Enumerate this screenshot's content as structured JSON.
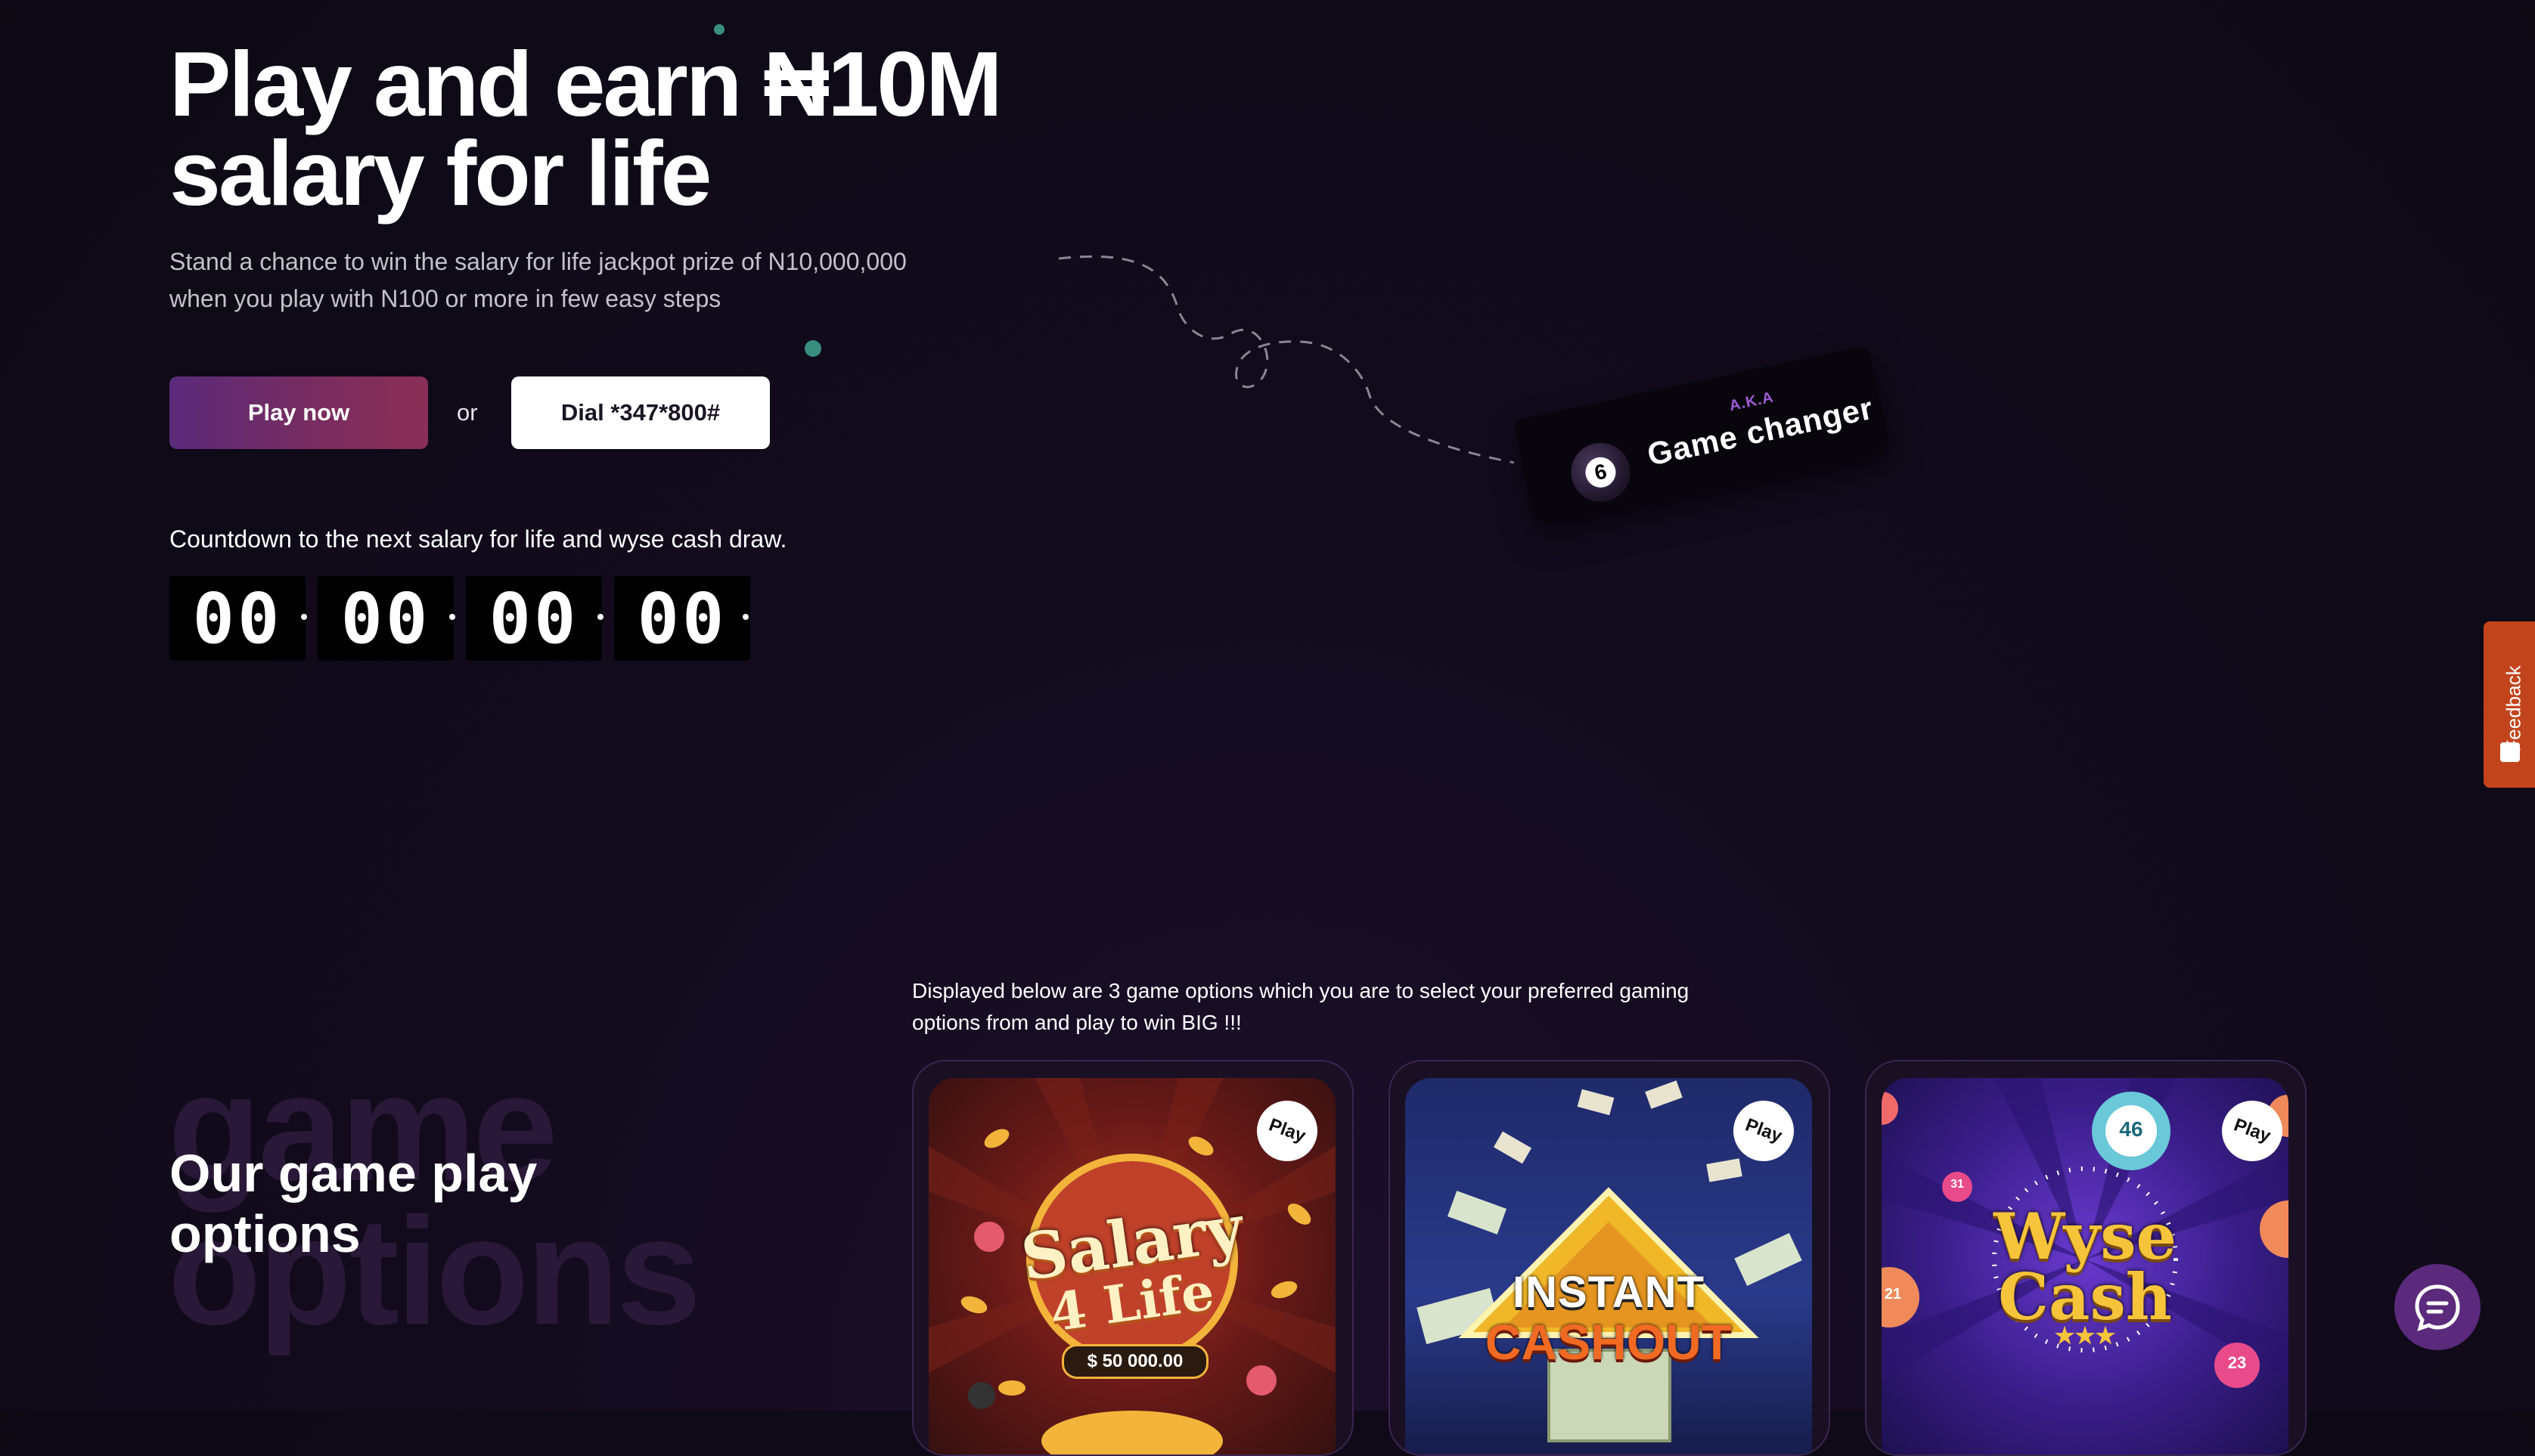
{
  "hero": {
    "title": "Play and earn ₦10M\nsalary for life",
    "subtitle": "Stand a chance to win the salary for life jackpot prize of N10,000,000 when you play with N100 or more in few easy steps",
    "play_button": "Play now",
    "or_text": "or",
    "dial_button": "Dial *347*800#",
    "countdown_label": "Countdown to the next salary for life and wyse cash draw.",
    "countdown": [
      "00",
      "00",
      "00",
      "00"
    ]
  },
  "tag": {
    "aka": "A.K.A",
    "ball_number": "6",
    "text": "Game changer"
  },
  "feedback": {
    "label": "Feedback"
  },
  "games_section": {
    "ghost_text_1": "game",
    "ghost_text_2": "options",
    "title": "Our game play\noptions",
    "description": "Displayed below are 3 game options which you are to select your preferred gaming options from and play to win BIG !!!",
    "cards": [
      {
        "badge": "Play",
        "logo_line1": "Salary",
        "logo_line2": "4 Life",
        "amount": "$ 50 000.00"
      },
      {
        "badge": "Play",
        "logo_line1": "INSTANT",
        "logo_line2": "CASHOUT"
      },
      {
        "badge": "Play",
        "logo_line1": "Wyse",
        "logo_line2": "Cash",
        "ball_1": "46",
        "ball_2": "23",
        "ball_3": "31",
        "ball_4": "21"
      }
    ]
  },
  "colors": {
    "play_gradient_start": "#5a2a7a",
    "play_gradient_end": "#8a2f55",
    "feedback": "#c2441c",
    "chat": "#5b2a7c"
  }
}
